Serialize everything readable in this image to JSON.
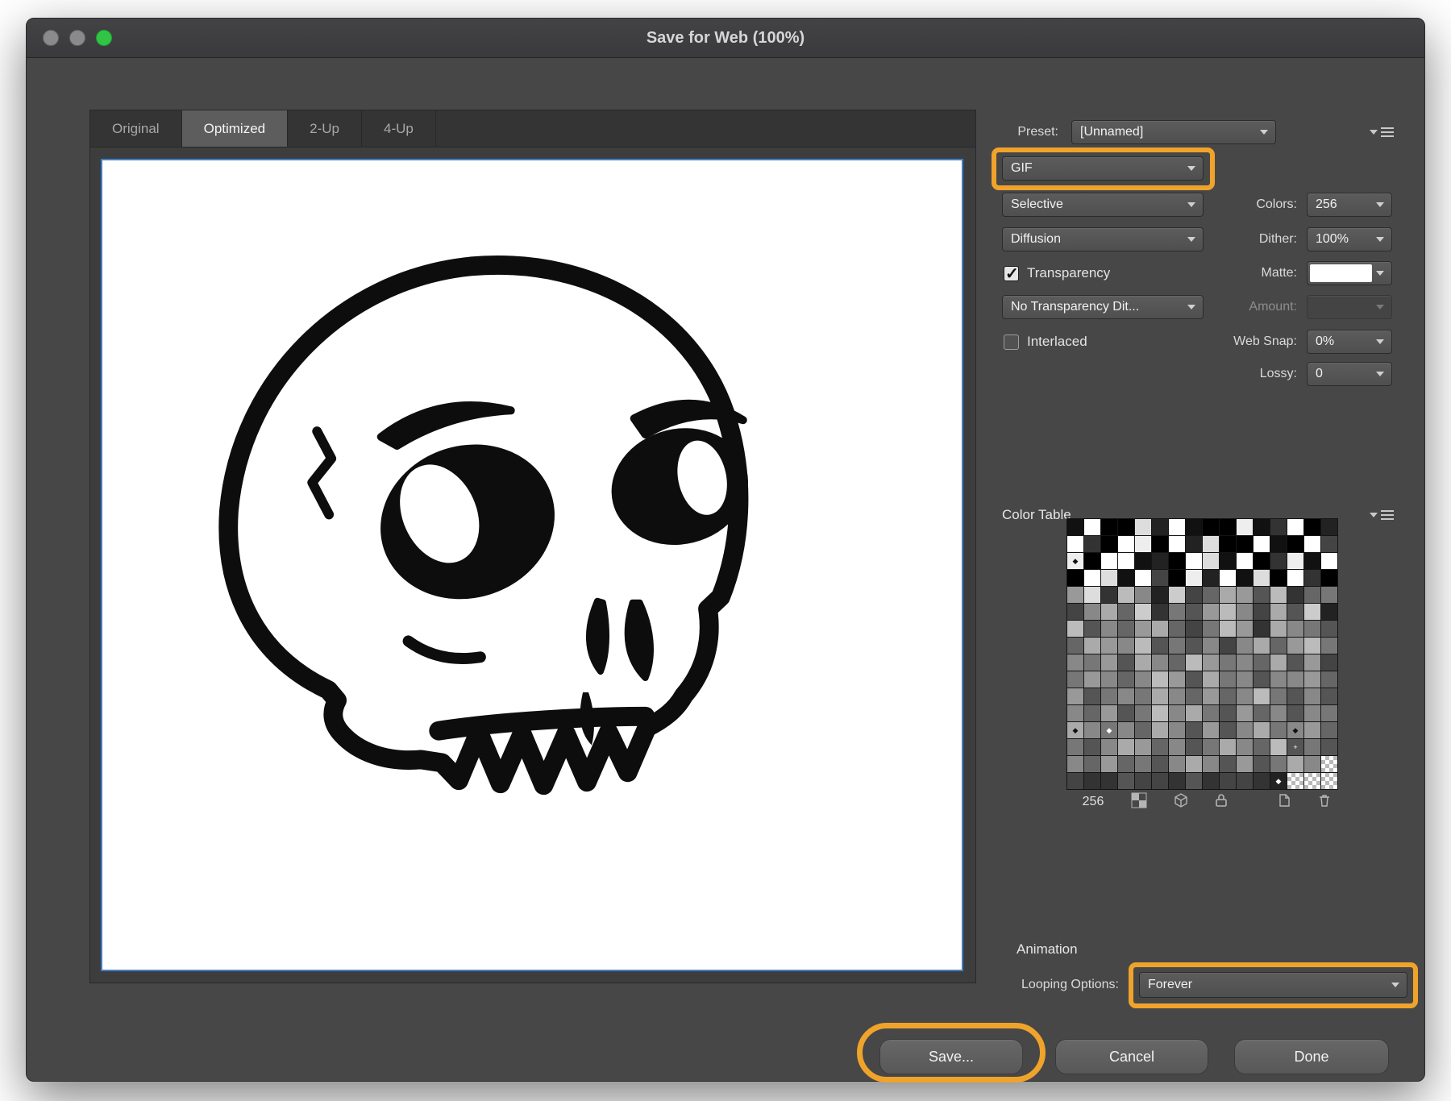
{
  "window": {
    "title": "Save for Web (100%)"
  },
  "tabs": [
    {
      "id": "original",
      "label": "Original",
      "active": false
    },
    {
      "id": "optimized",
      "label": "Optimized",
      "active": true
    },
    {
      "id": "2-up",
      "label": "2-Up",
      "active": false
    },
    {
      "id": "4-up",
      "label": "4-Up",
      "active": false
    }
  ],
  "settings": {
    "preset_label": "Preset:",
    "preset_value": "[Unnamed]",
    "format_value": "GIF",
    "reduction_value": "Selective",
    "colors_label": "Colors:",
    "colors_value": "256",
    "dither_method_value": "Diffusion",
    "dither_label": "Dither:",
    "dither_value": "100%",
    "transparency_label": "Transparency",
    "matte_label": "Matte:",
    "transparency_dither_value": "No Transparency Dit...",
    "amount_label": "Amount:",
    "interlaced_label": "Interlaced",
    "web_snap_label": "Web Snap:",
    "web_snap_value": "0%",
    "lossy_label": "Lossy:",
    "lossy_value": "0"
  },
  "color_table": {
    "title": "Color Table",
    "count": "256",
    "palette_rows": [
      "1f00d2f100e13f02",
      "f30fe0f2d00f10f4",
      "e0ff120fd1f03e1f",
      "0fd1f40e2f1d0f30",
      "9d3b82c46a95b367",
      "48a6c3759b84a5c2",
      "b5869a647b93a875",
      "6a98b575848a69b7",
      "8795a86b9786a594",
      "79868b95a7858896",
      "95787a86968b7585",
      "86957b8a75968587",
      "a8786a85958a7896",
      "758a96857a86b575",
      "8696758a85957a8t",
      "4335443534432ttt"
    ],
    "markers": [
      [
        2,
        0
      ],
      [
        12,
        0
      ],
      [
        12,
        2
      ],
      [
        12,
        13
      ],
      [
        15,
        12
      ]
    ],
    "plus_markers": [
      [
        13,
        13
      ]
    ]
  },
  "animation": {
    "section_label": "Animation",
    "looping_label": "Looping Options:",
    "looping_value": "Forever"
  },
  "buttons": {
    "save": "Save...",
    "cancel": "Cancel",
    "done": "Done"
  },
  "annotation": {
    "highlight_color": "#F0A32B"
  },
  "icons": {
    "checkmark": "✓",
    "swatch_marker": "◆",
    "swatch_plus": "+"
  }
}
